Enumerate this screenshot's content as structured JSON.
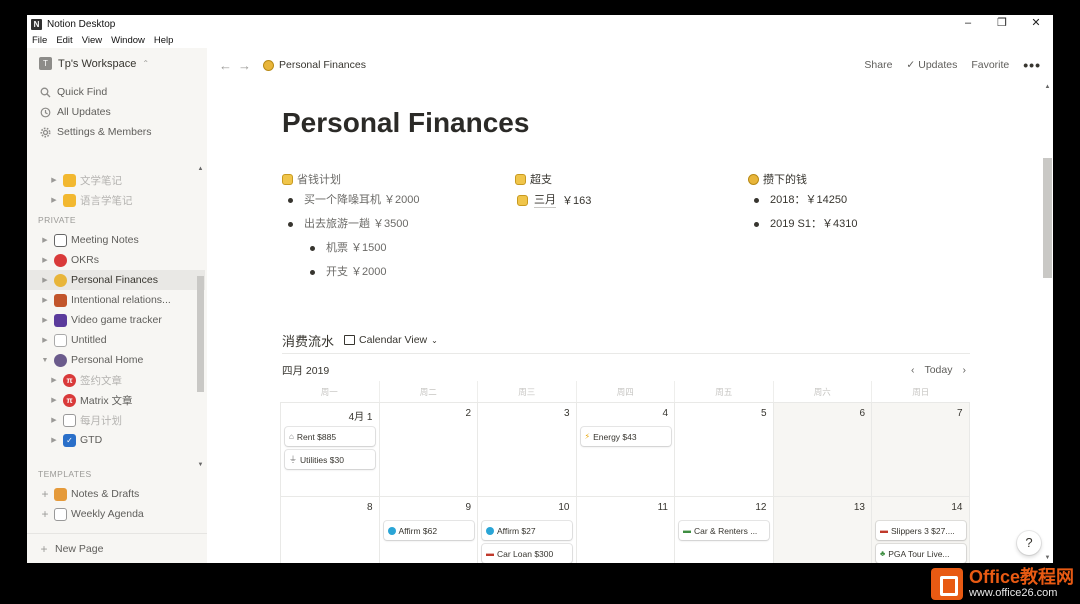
{
  "window": {
    "title": "Notion Desktop",
    "controls": {
      "minimize": "–",
      "maximize": "❐",
      "close": "✕"
    }
  },
  "menubar": [
    "File",
    "Edit",
    "View",
    "Window",
    "Help"
  ],
  "sidebar": {
    "workspace": {
      "badge": "T",
      "name": "Tp's Workspace",
      "caret": "⌃"
    },
    "top_items": [
      {
        "label": "Quick Find",
        "icon": "search-icon"
      },
      {
        "label": "All Updates",
        "icon": "clock-icon"
      },
      {
        "label": "Settings & Members",
        "icon": "gear-icon"
      }
    ],
    "tree_top": [
      {
        "label": "文学笔记",
        "faded": true
      },
      {
        "label": "语言学笔记",
        "faded": true
      }
    ],
    "private_label": "PRIVATE",
    "private_items": [
      {
        "label": "Meeting Notes"
      },
      {
        "label": "OKRs"
      },
      {
        "label": "Personal Finances",
        "active": true
      },
      {
        "label": "Intentional relations..."
      },
      {
        "label": "Video game tracker"
      },
      {
        "label": "Untitled"
      },
      {
        "label": "Personal Home",
        "expanded": true
      },
      {
        "label": "签约文章",
        "faded": true
      },
      {
        "label": "Matrix 文章",
        "faded": true
      },
      {
        "label": "每月计划",
        "faded": true
      },
      {
        "label": "GTD"
      }
    ],
    "templates_label": "TEMPLATES",
    "templates": [
      {
        "label": "Notes & Drafts"
      },
      {
        "label": "Weekly Agenda"
      }
    ],
    "new_page": "New Page"
  },
  "topbar": {
    "breadcrumb": "Personal Finances",
    "share": "Share",
    "updates": "Updates",
    "favorite": "Favorite",
    "more": "•••"
  },
  "page": {
    "title": "Personal Finances",
    "columns": {
      "save": {
        "heading": "省钱计划",
        "items": [
          {
            "text": "买一个降噪耳机 ￥2000",
            "level": 0
          },
          {
            "text": "出去旅游一趟 ￥3500",
            "level": 0
          },
          {
            "text": "机票 ￥1500",
            "level": 1
          },
          {
            "text": "开支 ￥2000",
            "level": 1
          }
        ]
      },
      "over": {
        "heading": "超支",
        "link_text": "三月",
        "link_amount": "￥163"
      },
      "saved": {
        "heading": "攒下的钱",
        "items": [
          {
            "text": "2018：￥14250"
          },
          {
            "text": "2019 S1：￥4310"
          }
        ]
      }
    },
    "calendar": {
      "title": "消费流水",
      "view_label": "Calendar View",
      "month": "四月 2019",
      "today": "Today",
      "weekdays": [
        "周一",
        "周二",
        "周三",
        "周四",
        "周五",
        "周六",
        "周日"
      ],
      "week1": [
        "4月 1",
        "2",
        "3",
        "4",
        "5",
        "6",
        "7"
      ],
      "week2": [
        "8",
        "9",
        "10",
        "11",
        "12",
        "13",
        "14"
      ],
      "cards": {
        "rent": "Rent $885",
        "utilities": "Utilities $30",
        "energy": "Energy $43",
        "affirm62": "Affirm $62",
        "affirm27": "Affirm $27",
        "carloan": "Car Loan $300",
        "car_renters": "Car & Renters ...",
        "slippers": "Slippers 3 $27....",
        "pga": "PGA Tour Live..."
      }
    }
  },
  "help_label": "?",
  "watermark": {
    "title": "Office教程网",
    "url": "www.office26.com"
  },
  "colors": {
    "sidebar_bg": "#f7f6f3",
    "active_row": "#e9e8e5",
    "watermark_orange": "#e85a13"
  }
}
